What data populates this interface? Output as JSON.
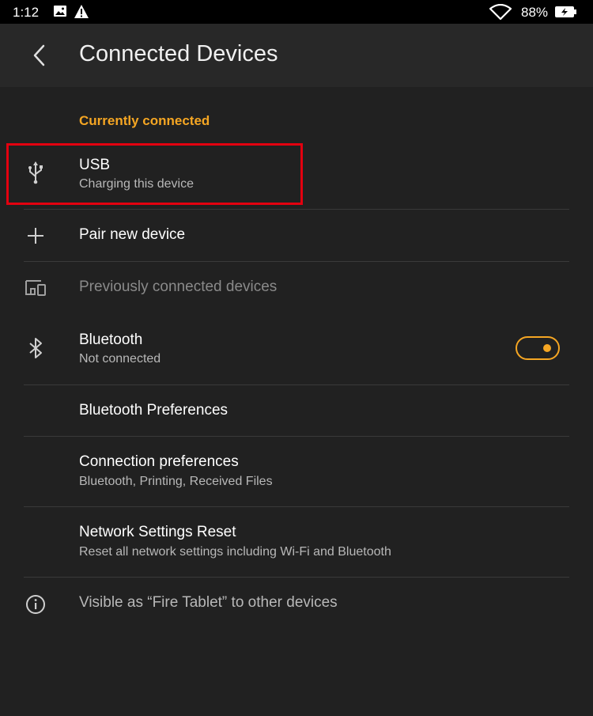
{
  "status_bar": {
    "time": "1:12",
    "battery_percent": "88%",
    "icons": [
      "image-icon",
      "warning-icon",
      "wifi-icon",
      "battery-charging-icon"
    ]
  },
  "header": {
    "title": "Connected Devices",
    "back_icon": "back-arrow-icon"
  },
  "current_section": {
    "label": "Currently connected",
    "color": "#f5a623"
  },
  "usb": {
    "title": "USB",
    "subtitle": "Charging this device",
    "icon": "usb-icon",
    "highlight_color": "#e3000f"
  },
  "pair": {
    "title": "Pair new device",
    "icon": "plus-icon"
  },
  "previous": {
    "title": "Previously connected devices",
    "icon": "devices-icon"
  },
  "bluetooth": {
    "title": "Bluetooth",
    "subtitle": "Not connected",
    "icon": "bluetooth-icon",
    "toggle_on": true,
    "accent_color": "#f5a623"
  },
  "bt_prefs": {
    "title": "Bluetooth Preferences"
  },
  "conn_prefs": {
    "title": "Connection preferences",
    "subtitle": "Bluetooth, Printing, Received Files"
  },
  "network_reset": {
    "title": "Network Settings Reset",
    "subtitle": "Reset all network settings including Wi-Fi and Bluetooth"
  },
  "visibility": {
    "text": "Visible as “Fire Tablet” to other devices",
    "icon": "info-icon"
  }
}
